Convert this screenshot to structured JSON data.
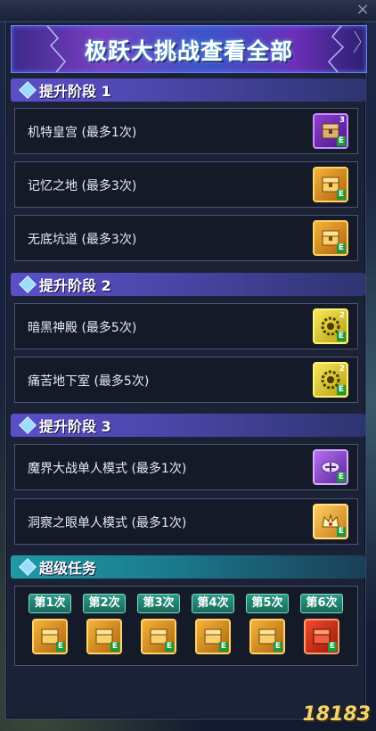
{
  "window": {
    "close_glyph": "×"
  },
  "banner": {
    "title": "极跃大挑战查看全部"
  },
  "sections": [
    {
      "title": "提升阶段 1",
      "items": [
        {
          "label": "机特皇宫 (最多1次)",
          "icon": "purple-treasure-chest-icon",
          "badge": "3"
        },
        {
          "label": "记忆之地 (最多3次)",
          "icon": "gold-treasure-chest-icon",
          "badge": ""
        },
        {
          "label": "无底坑道 (最多3次)",
          "icon": "gold-treasure-chest-icon",
          "badge": ""
        }
      ]
    },
    {
      "title": "提升阶段 2",
      "items": [
        {
          "label": "暗黑神殿 (最多5次)",
          "icon": "free-gear-ticket-icon",
          "badge": "2"
        },
        {
          "label": "痛苦地下室 (最多5次)",
          "icon": "free-gear-ticket-icon",
          "badge": "2"
        }
      ]
    },
    {
      "title": "提升阶段 3",
      "items": [
        {
          "label": "魔界大战单人模式 (最多1次)",
          "icon": "violet-emblem-icon",
          "badge": ""
        },
        {
          "label": "洞察之眼单人模式 (最多1次)",
          "icon": "golden-crown-item-icon",
          "badge": ""
        }
      ]
    }
  ],
  "super_task": {
    "title": "超级任务",
    "tiers": [
      {
        "label": "第1次",
        "icon": "gold-treasure-chest-icon"
      },
      {
        "label": "第2次",
        "icon": "gold-treasure-chest-icon"
      },
      {
        "label": "第3次",
        "icon": "gold-treasure-chest-icon"
      },
      {
        "label": "第4次",
        "icon": "gold-treasure-chest-icon"
      },
      {
        "label": "第5次",
        "icon": "gold-treasure-chest-icon"
      },
      {
        "label": "第6次",
        "icon": "red-treasure-chest-icon"
      }
    ]
  },
  "watermark": "18183",
  "colors": {
    "purple_header": "#5b4fc8",
    "teal_header": "#1f9aa6",
    "row_bg": "#151a29",
    "gold": "#f4b43a"
  }
}
